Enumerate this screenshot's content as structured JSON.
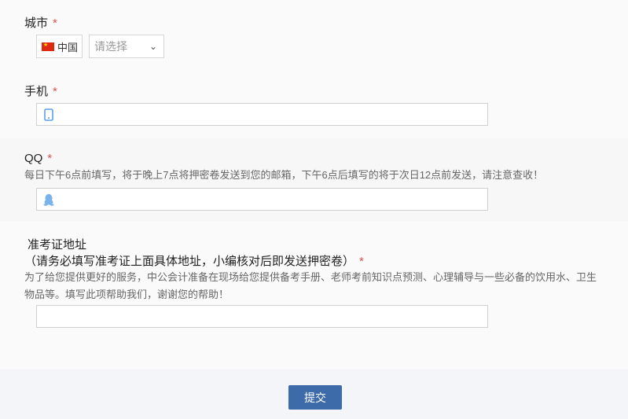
{
  "city": {
    "label": "城市",
    "required_mark": "*",
    "country_code": "中国",
    "select_placeholder": "请选择"
  },
  "phone": {
    "label": "手机",
    "required_mark": "*",
    "value": ""
  },
  "qq": {
    "label": "QQ",
    "required_mark": "*",
    "hint": "每日下午6点前填写，将于晚上7点将押密卷发送到您的邮箱，下午6点后填写的将于次日12点前发送，请注意查收！",
    "value": ""
  },
  "address": {
    "label_line1": "准考证地址",
    "label_line2": "（请务必填写准考证上面具体地址，小编核对后即发送押密卷）",
    "required_mark": "*",
    "hint": "为了给您提供更好的服务，中公会计准备在现场给您提供备考手册、老师考前知识点预测、心理辅导与一些必备的饮用水、卫生物品等。填写此项帮助我们，谢谢您的帮助！",
    "value": ""
  },
  "submit": {
    "label": "提交"
  },
  "colors": {
    "required": "#d9534f",
    "button": "#3d6aa8",
    "section_bg": "#f7f7f7",
    "phone_icon": "#5aa0e8",
    "qq_icon": "#7ab3ea"
  }
}
